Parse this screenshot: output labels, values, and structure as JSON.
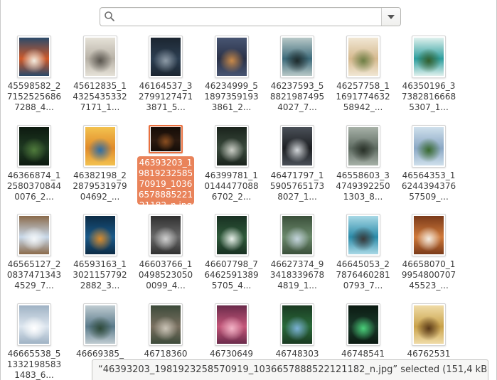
{
  "search": {
    "placeholder": "",
    "value": ""
  },
  "items": [
    {
      "label": "45598582_271525256867288_4...",
      "selected": false,
      "colors": [
        "#d05a2a",
        "#f1ece0",
        "#2a4a6a"
      ]
    },
    {
      "label": "45612835_143254353327171_1...",
      "selected": false,
      "colors": [
        "#b7b1a6",
        "#5b5750",
        "#e6e2d8"
      ]
    },
    {
      "label": "46164537_327991274713871_5...",
      "selected": false,
      "colors": [
        "#2d3f52",
        "#8d9aa6",
        "#1b2530"
      ]
    },
    {
      "label": "46234999_518973591933861_2...",
      "selected": false,
      "colors": [
        "#2a3147",
        "#c98a4a",
        "#485572"
      ]
    },
    {
      "label": "46237593_588219874954027_7...",
      "selected": false,
      "colors": [
        "#3c6a7a",
        "#1f2b2c",
        "#b9c9c8"
      ]
    },
    {
      "label": "46257758_1169177463258942_...",
      "selected": false,
      "colors": [
        "#d5b98e",
        "#6e7f46",
        "#f1e7d4"
      ]
    },
    {
      "label": "46350196_373828166685307_1...",
      "selected": false,
      "colors": [
        "#2c9d9d",
        "#355f2e",
        "#e0f1ee"
      ]
    },
    {
      "label": "46366874_125803708440076_2...",
      "selected": false,
      "colors": [
        "#1f3a22",
        "#4f7a3b",
        "#0d1a10"
      ]
    },
    {
      "label": "46382198_2287953197904692_...",
      "selected": false,
      "colors": [
        "#e08a2a",
        "#2e6fa6",
        "#f3c24f"
      ]
    },
    {
      "label": "46393203_1981923258570919_1036657888522121182_n.jpg",
      "selected": true,
      "colors": [
        "#2b1a10",
        "#8a4e20",
        "#140c07"
      ]
    },
    {
      "label": "46399781_101444770886702_2...",
      "selected": false,
      "colors": [
        "#3a4a3c",
        "#c9ccc4",
        "#1a231c"
      ]
    },
    {
      "label": "46471797_159057651738027_1...",
      "selected": false,
      "colors": [
        "#1d1f22",
        "#d2d6da",
        "#4a5058"
      ]
    },
    {
      "label": "46558603_347493922501303_8...",
      "selected": false,
      "colors": [
        "#5d6a60",
        "#2a3229",
        "#a7b1a8"
      ]
    },
    {
      "label": "46564353_1624439437657509_...",
      "selected": false,
      "colors": [
        "#8aa7c4",
        "#3a6a2f",
        "#cfe0ec"
      ]
    },
    {
      "label": "46565127_208374713434529_7...",
      "selected": false,
      "colors": [
        "#c9d9ea",
        "#f3f6f8",
        "#8a6a4a"
      ]
    },
    {
      "label": "46593163_130211577922882_3...",
      "selected": false,
      "colors": [
        "#1a5a8a",
        "#d88a2a",
        "#0c2b45"
      ]
    },
    {
      "label": "46603766_104985230500099_4...",
      "selected": false,
      "colors": [
        "#6a6a6a",
        "#cfcfcf",
        "#2f2f2f"
      ]
    },
    {
      "label": "46607798_764625913895705_4...",
      "selected": false,
      "colors": [
        "#2f5a3a",
        "#e7efe9",
        "#183022"
      ]
    },
    {
      "label": "46627374_934183396784819_1...",
      "selected": false,
      "colors": [
        "#6c8a6c",
        "#c3d3dc",
        "#3a4f3a"
      ]
    },
    {
      "label": "46645053_278764602810793_7...",
      "selected": false,
      "colors": [
        "#2a8aa8",
        "#3a3a3a",
        "#a9d9e6"
      ]
    },
    {
      "label": "46658070_1995480070745523_...",
      "selected": false,
      "colors": [
        "#d07a3a",
        "#f3ece2",
        "#7a3a1a"
      ]
    },
    {
      "label": "46665538_513321985831483_6...",
      "selected": false,
      "colors": [
        "#dde6ef",
        "#ffffff",
        "#9fb2c4"
      ]
    },
    {
      "label": "46669385_3...",
      "selected": false,
      "colors": [
        "#5a7a8a",
        "#2f4a3a",
        "#c0ccd2"
      ]
    },
    {
      "label": "46718360",
      "selected": false,
      "colors": [
        "#7a7060",
        "#c9c3b6",
        "#3c4a3a"
      ]
    },
    {
      "label": "46730649",
      "selected": false,
      "colors": [
        "#c4577a",
        "#f1b3c6",
        "#6a2a4a"
      ]
    },
    {
      "label": "46748303",
      "selected": false,
      "colors": [
        "#2a6a3a",
        "#7ab0d6",
        "#1a3a22"
      ]
    },
    {
      "label": "46748541",
      "selected": false,
      "colors": [
        "#1a3a2a",
        "#4ad07a",
        "#0b1a12"
      ]
    },
    {
      "label": "46762531",
      "selected": false,
      "colors": [
        "#c9a24a",
        "#5a3a1a",
        "#f0dca8"
      ]
    }
  ],
  "status": {
    "text": "“46393203_1981923258570919_1036657888522121182_n.jpg” selected  (151,4 kB)"
  }
}
